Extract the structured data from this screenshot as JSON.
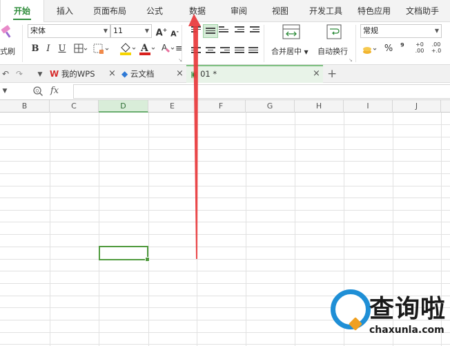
{
  "menu": {
    "tabs": [
      "开始",
      "插入",
      "页面布局",
      "公式",
      "数据",
      "审阅",
      "视图",
      "开发工具",
      "特色应用",
      "文档助手"
    ],
    "active_tab": "开始"
  },
  "ribbon": {
    "format_painter_label": "式刷",
    "font_name": "宋体",
    "font_size": "11",
    "grow_font": "A⁺",
    "shrink_font": "A⁻",
    "bold": "B",
    "italic": "I",
    "underline": "U",
    "merge_center_label": "合并居中",
    "wrap_text_label": "自动换行",
    "number_format": "常规",
    "percent": "%",
    "comma": "⁹",
    "inc_decimal": "+0\n.00",
    "dec_decimal": ".00\n+.0",
    "accent_color": "#2e8c3a",
    "font_color": "#d9201c",
    "fill_color": "#f6d400"
  },
  "docbar": {
    "tabs": [
      {
        "label": "我的WPS",
        "icon": "wps-logo-icon"
      },
      {
        "label": "云文档",
        "icon": "cloud-doc-icon"
      },
      {
        "label": "01 *",
        "icon": "spreadsheet-icon"
      }
    ],
    "new_tab": "+"
  },
  "fxbar": {
    "fx_label": "fx",
    "formula": ""
  },
  "columns": [
    "B",
    "C",
    "D",
    "E",
    "F",
    "G",
    "H",
    "I",
    "J"
  ],
  "selected_column": "D",
  "selected_cell": "D12",
  "annotation": {
    "color": "#e8383b"
  },
  "watermark": {
    "title": "查询啦",
    "url": "chaxunla.com",
    "logo_color": "#1f8fd6"
  }
}
